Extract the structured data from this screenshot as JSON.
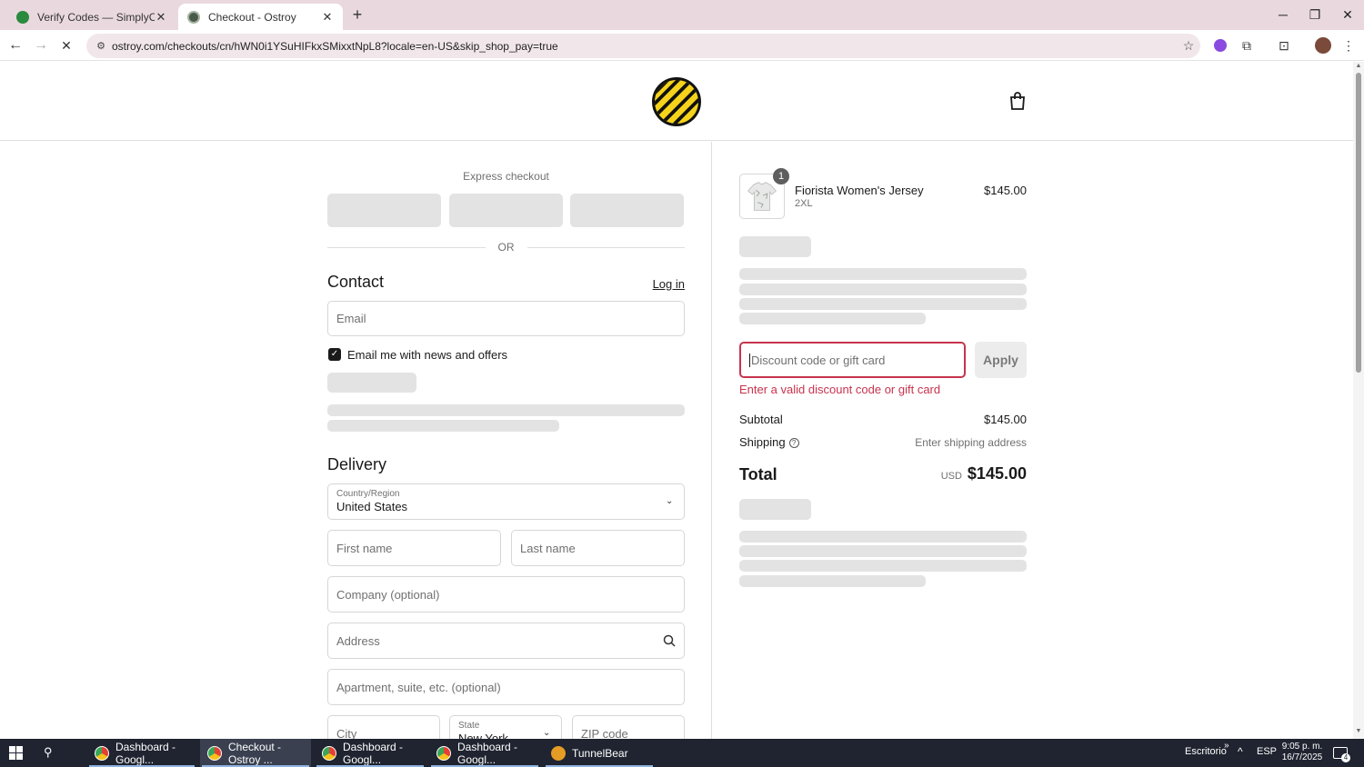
{
  "browser": {
    "tabs": [
      {
        "title": "Verify Codes — SimplyCodes",
        "active": false
      },
      {
        "title": "Checkout - Ostroy",
        "active": true
      }
    ],
    "url": "ostroy.com/checkouts/cn/hWN0i1YSuHIFkxSMixxtNpL8?locale=en-US&skip_shop_pay=true"
  },
  "checkout": {
    "express_title": "Express checkout",
    "or_label": "OR",
    "contact": {
      "heading": "Contact",
      "login_label": "Log in",
      "email_placeholder": "Email",
      "newsletter_label": "Email me with news and offers",
      "newsletter_checked": true
    },
    "delivery": {
      "heading": "Delivery",
      "country_label": "Country/Region",
      "country_value": "United States",
      "first_name_placeholder": "First name",
      "last_name_placeholder": "Last name",
      "company_placeholder": "Company (optional)",
      "address_placeholder": "Address",
      "apartment_placeholder": "Apartment, suite, etc. (optional)",
      "city_placeholder": "City",
      "state_label": "State",
      "state_value": "New York",
      "zip_placeholder": "ZIP code"
    }
  },
  "summary": {
    "item": {
      "name": "Fiorista Women's Jersey",
      "variant": "2XL",
      "price": "$145.00",
      "quantity": "1"
    },
    "discount_placeholder": "Discount code or gift card",
    "apply_label": "Apply",
    "discount_error": "Enter a valid discount code or gift card",
    "subtotal_label": "Subtotal",
    "subtotal_value": "$145.00",
    "shipping_label": "Shipping",
    "shipping_value": "Enter shipping address",
    "total_label": "Total",
    "total_currency": "USD",
    "total_value": "$145.00"
  },
  "taskbar": {
    "items": [
      {
        "label": "Dashboard - Googl...",
        "icon": "chrome-icon"
      },
      {
        "label": "Checkout - Ostroy ...",
        "icon": "chrome-icon",
        "active": true
      },
      {
        "label": "Dashboard - Googl...",
        "icon": "chrome-icon"
      },
      {
        "label": "Dashboard - Googl...",
        "icon": "chrome-icon"
      },
      {
        "label": "TunnelBear",
        "icon": "tunnelbear-icon"
      }
    ],
    "desktop_label": "Escritorio",
    "language": "ESP",
    "time": "9:05 p. m.",
    "date": "16/7/2025",
    "notification_count": "4"
  },
  "colors": {
    "accent_error": "#c8334d",
    "logo_yellow": "#f5d31a",
    "tab_strip": "#e9d9de"
  }
}
